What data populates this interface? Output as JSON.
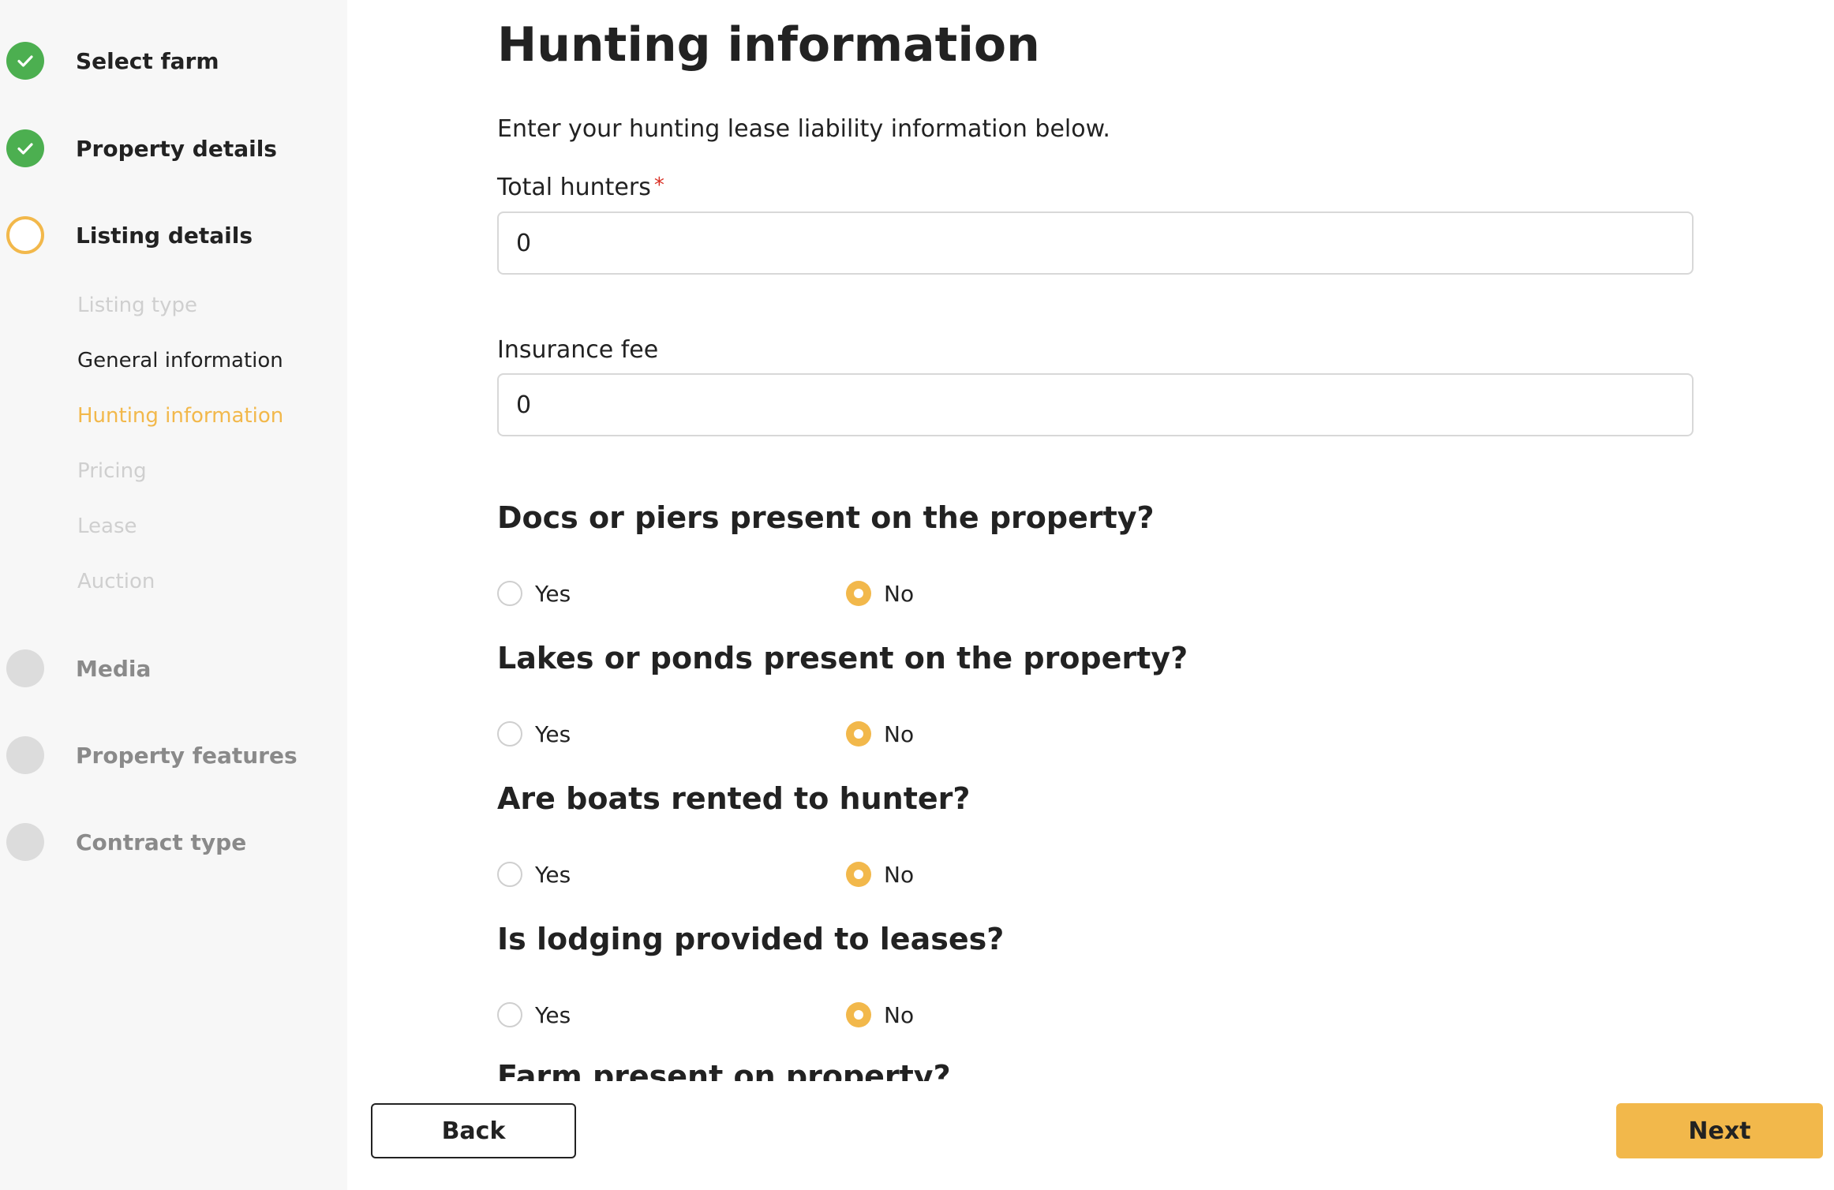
{
  "sidebar": {
    "steps": [
      {
        "label": "Select farm",
        "status": "done"
      },
      {
        "label": "Property details",
        "status": "done"
      },
      {
        "label": "Listing details",
        "status": "current"
      },
      {
        "label": "Media",
        "status": "pending"
      },
      {
        "label": "Property features",
        "status": "pending"
      },
      {
        "label": "Contract type",
        "status": "pending"
      }
    ],
    "substeps": [
      {
        "label": "Listing type"
      },
      {
        "label": "General information"
      },
      {
        "label": "Hunting information"
      },
      {
        "label": "Pricing"
      },
      {
        "label": "Lease"
      },
      {
        "label": "Auction"
      }
    ]
  },
  "main": {
    "title": "Hunting information",
    "subtitle": "Enter your hunting lease liability information below.",
    "fields": {
      "total_hunters": {
        "label": "Total hunters",
        "required_mark": "*",
        "value": "0"
      },
      "insurance_fee": {
        "label": "Insurance fee",
        "value": "0"
      }
    },
    "questions": [
      {
        "text": "Docs or piers present on the property?",
        "yes": "Yes",
        "no": "No",
        "selected": "No"
      },
      {
        "text": "Lakes or ponds present on the property?",
        "yes": "Yes",
        "no": "No",
        "selected": "No"
      },
      {
        "text": "Are boats rented to hunter?",
        "yes": "Yes",
        "no": "No",
        "selected": "No"
      },
      {
        "text": "Is lodging provided to leases?",
        "yes": "Yes",
        "no": "No",
        "selected": "No"
      }
    ],
    "partial_question": "Farm present on property?"
  },
  "footer": {
    "back_label": "Back",
    "next_label": "Next"
  },
  "colors": {
    "accent": "#f2b84b",
    "done": "#4caf50",
    "pending": "#dcdcdc",
    "required": "#d93025"
  }
}
